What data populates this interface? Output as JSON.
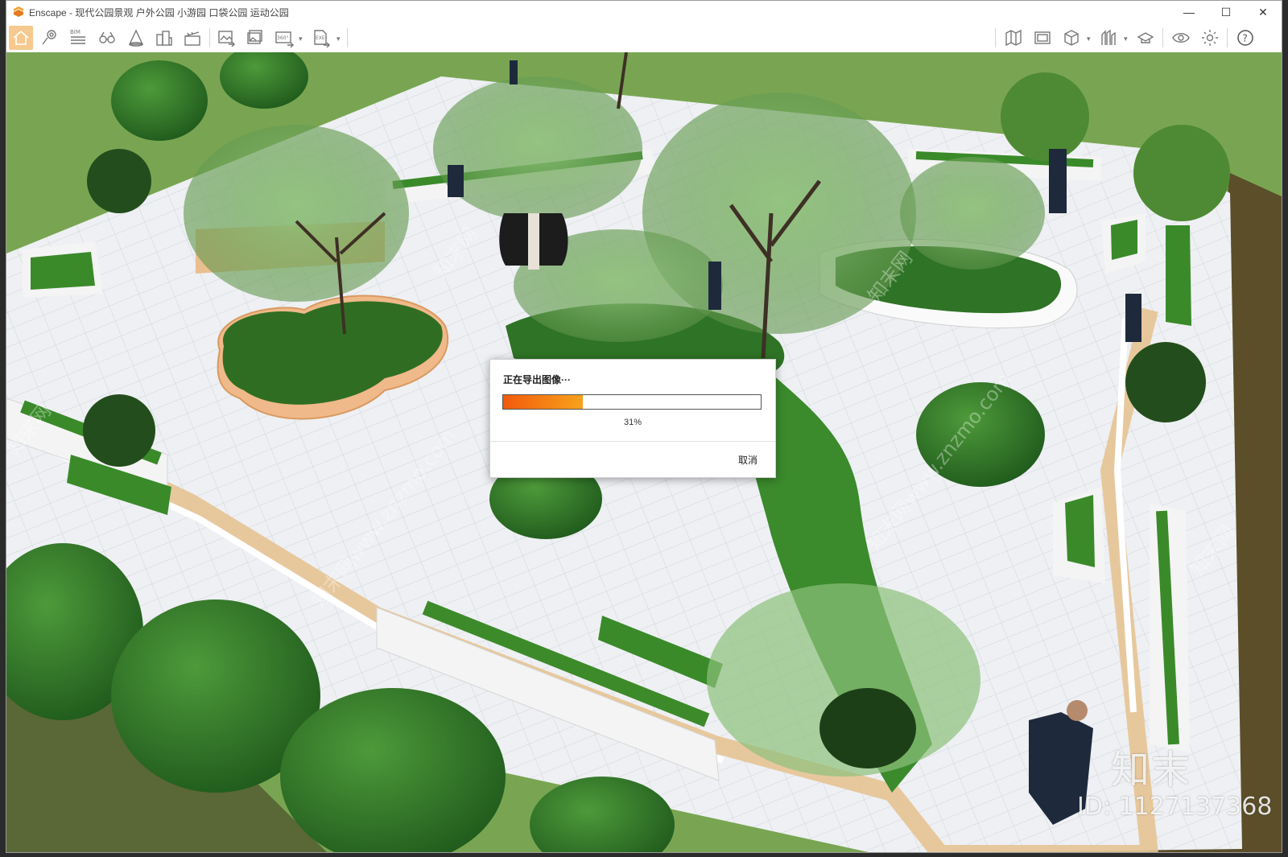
{
  "window": {
    "title": "Enscape - 现代公园景观 户外公园 小游园 口袋公园 运动公园",
    "controls": [
      "—",
      "☐",
      "✕"
    ]
  },
  "toolbar": {
    "left_icons": [
      "home-icon",
      "pin-icon",
      "bim-icon",
      "binoculars-icon",
      "cone-icon",
      "buildings-icon",
      "clapper-icon",
      "export-image-icon",
      "export-batch-icon",
      "export-360-icon",
      "export-exe-icon"
    ],
    "right_icons": [
      "map-icon",
      "panorama-icon",
      "cube-icon",
      "asset-library-icon",
      "hat-icon",
      "eye-icon",
      "gear-icon",
      "help-icon"
    ],
    "bim_label": "BIM",
    "label_360": "360°",
    "label_exe": "EXE",
    "help_label": "?",
    "accent": "#f3a233",
    "home_bg": "#f6c98e"
  },
  "dialog": {
    "title": "正在导出图像···",
    "progress": 0.31,
    "progress_label": "31%",
    "cancel_label": "取消"
  },
  "watermark": {
    "logo_text": "知末",
    "id_text": "ID: 1127137368",
    "diagonal_text": "知末网www.znzmo.com"
  }
}
